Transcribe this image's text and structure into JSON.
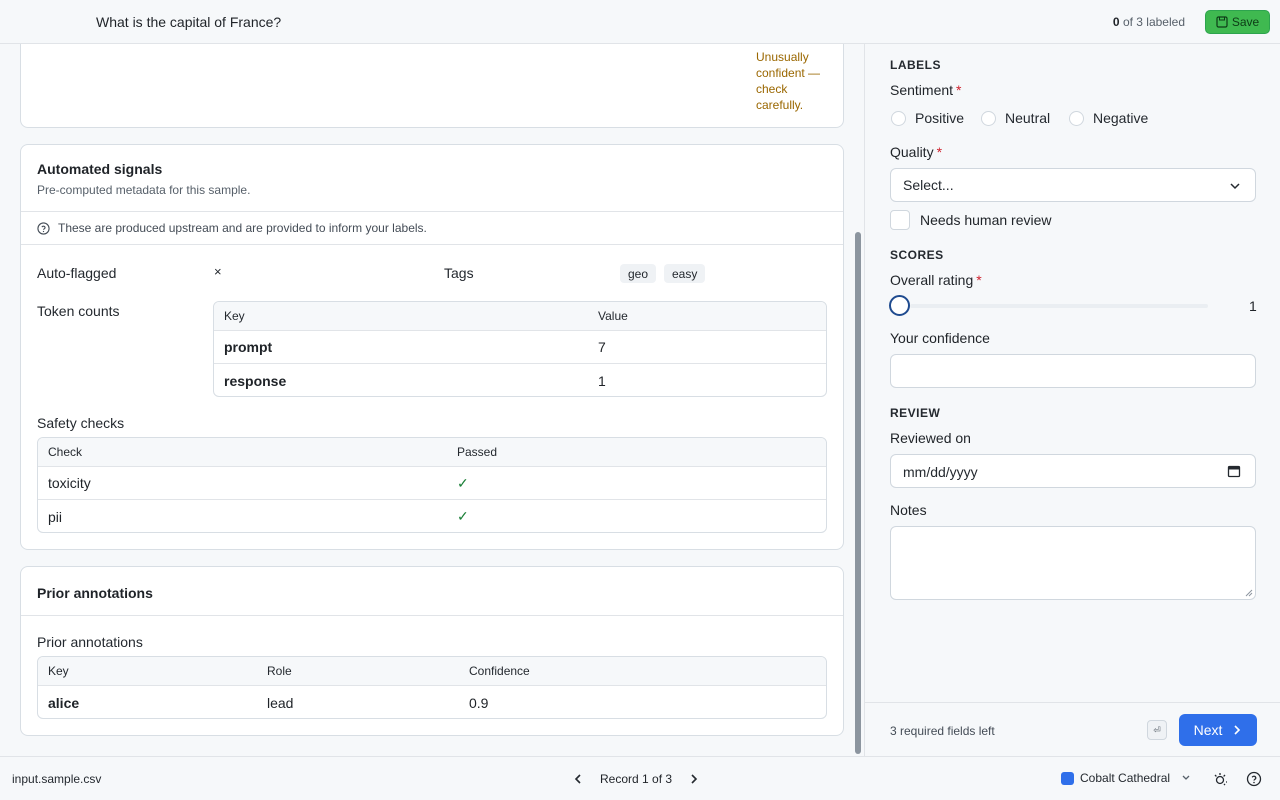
{
  "header": {
    "question": "What is the capital of France?",
    "labeled_count": "0",
    "labeled_suffix": " of 3 labeled",
    "save_label": "Save"
  },
  "record_card": {
    "warning": "Unusually confident — check carefully."
  },
  "signals": {
    "title": "Automated signals",
    "subtitle": "Pre-computed metadata for this sample.",
    "info": "These are produced upstream and are provided to inform your labels.",
    "auto_flagged_label": "Auto-flagged",
    "auto_flagged_value": "×",
    "tags_label": "Tags",
    "tags": [
      "geo",
      "easy"
    ],
    "token_counts_label": "Token counts",
    "token_table": {
      "headers": [
        "Key",
        "Value"
      ],
      "rows": [
        [
          "prompt",
          "7"
        ],
        [
          "response",
          "1"
        ]
      ]
    },
    "safety_label": "Safety checks",
    "safety_table": {
      "headers": [
        "Check",
        "Passed"
      ],
      "rows": [
        [
          "toxicity",
          "✓"
        ],
        [
          "pii",
          "✓"
        ]
      ]
    }
  },
  "prior": {
    "title": "Prior annotations",
    "label": "Prior annotations",
    "headers": [
      "Key",
      "Role",
      "Confidence"
    ],
    "rows": [
      [
        "alice",
        "lead",
        "0.9"
      ]
    ]
  },
  "form": {
    "labels_section": "LABELS",
    "sentiment_label": "Sentiment",
    "sentiment_options": [
      "Positive",
      "Neutral",
      "Negative"
    ],
    "quality_label": "Quality",
    "quality_value": "Select...",
    "needs_review_label": "Needs human review",
    "scores_section": "SCORES",
    "rating_label": "Overall rating",
    "rating_value": "1",
    "confidence_label": "Your confidence",
    "confidence_value": "",
    "review_section": "REVIEW",
    "reviewed_on_label": "Reviewed on",
    "reviewed_on_placeholder": "mm/dd/yyyy",
    "notes_label": "Notes",
    "notes_value": "",
    "required_asterisk": "*"
  },
  "form_footer": {
    "required_left": "3 required fields left",
    "enter_key": "⏎",
    "next_label": "Next"
  },
  "footer": {
    "filename": "input.sample.csv",
    "record_label": "Record 1 of 3",
    "theme_name": "Cobalt Cathedral"
  },
  "colors": {
    "accent": "#2f6fea",
    "save": "#3fb950",
    "warning": "#9a6700",
    "check": "#1a7f37"
  }
}
